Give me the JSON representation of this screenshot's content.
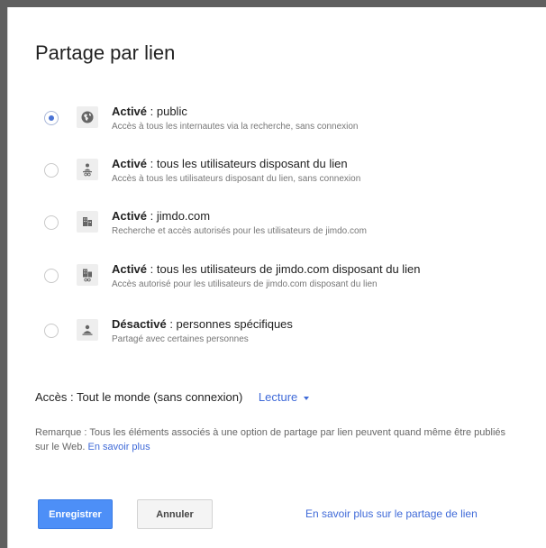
{
  "dialog": {
    "title": "Partage par lien"
  },
  "options": [
    {
      "status": "Activé",
      "label": " : public",
      "description": "Accès à tous les internautes via la recherche, sans connexion",
      "icon": "globe-icon",
      "selected": true
    },
    {
      "status": "Activé",
      "label": " : tous les utilisateurs disposant du lien",
      "description": "Accès à tous les utilisateurs disposant du lien, sans connexion",
      "icon": "person-link-icon",
      "selected": false
    },
    {
      "status": "Activé",
      "label": " : jimdo.com",
      "description": "Recherche et accès autorisés pour les utilisateurs de jimdo.com",
      "icon": "building-icon",
      "selected": false
    },
    {
      "status": "Activé",
      "label": " : tous les utilisateurs de jimdo.com disposant du lien",
      "description": "Accès autorisé pour les utilisateurs de jimdo.com disposant du lien",
      "icon": "building-link-icon",
      "selected": false
    },
    {
      "status": "Désactivé",
      "label": " : personnes spécifiques",
      "description": "Partagé avec certaines personnes",
      "icon": "person-lock-icon",
      "selected": false
    }
  ],
  "access": {
    "label": "Accès :",
    "value": "Tout le monde (sans connexion)",
    "level": "Lecture"
  },
  "note": {
    "text": "Remarque : Tous les éléments associés à une option de partage par lien peuvent quand même être publiés sur le Web. ",
    "link": "En savoir plus"
  },
  "buttons": {
    "save": "Enregistrer",
    "cancel": "Annuler"
  },
  "footer_link": "En savoir plus sur le partage de lien",
  "colors": {
    "accent": "#4d8ff7",
    "link": "#3f6ad8",
    "radio_selected": "#4a73d5"
  }
}
